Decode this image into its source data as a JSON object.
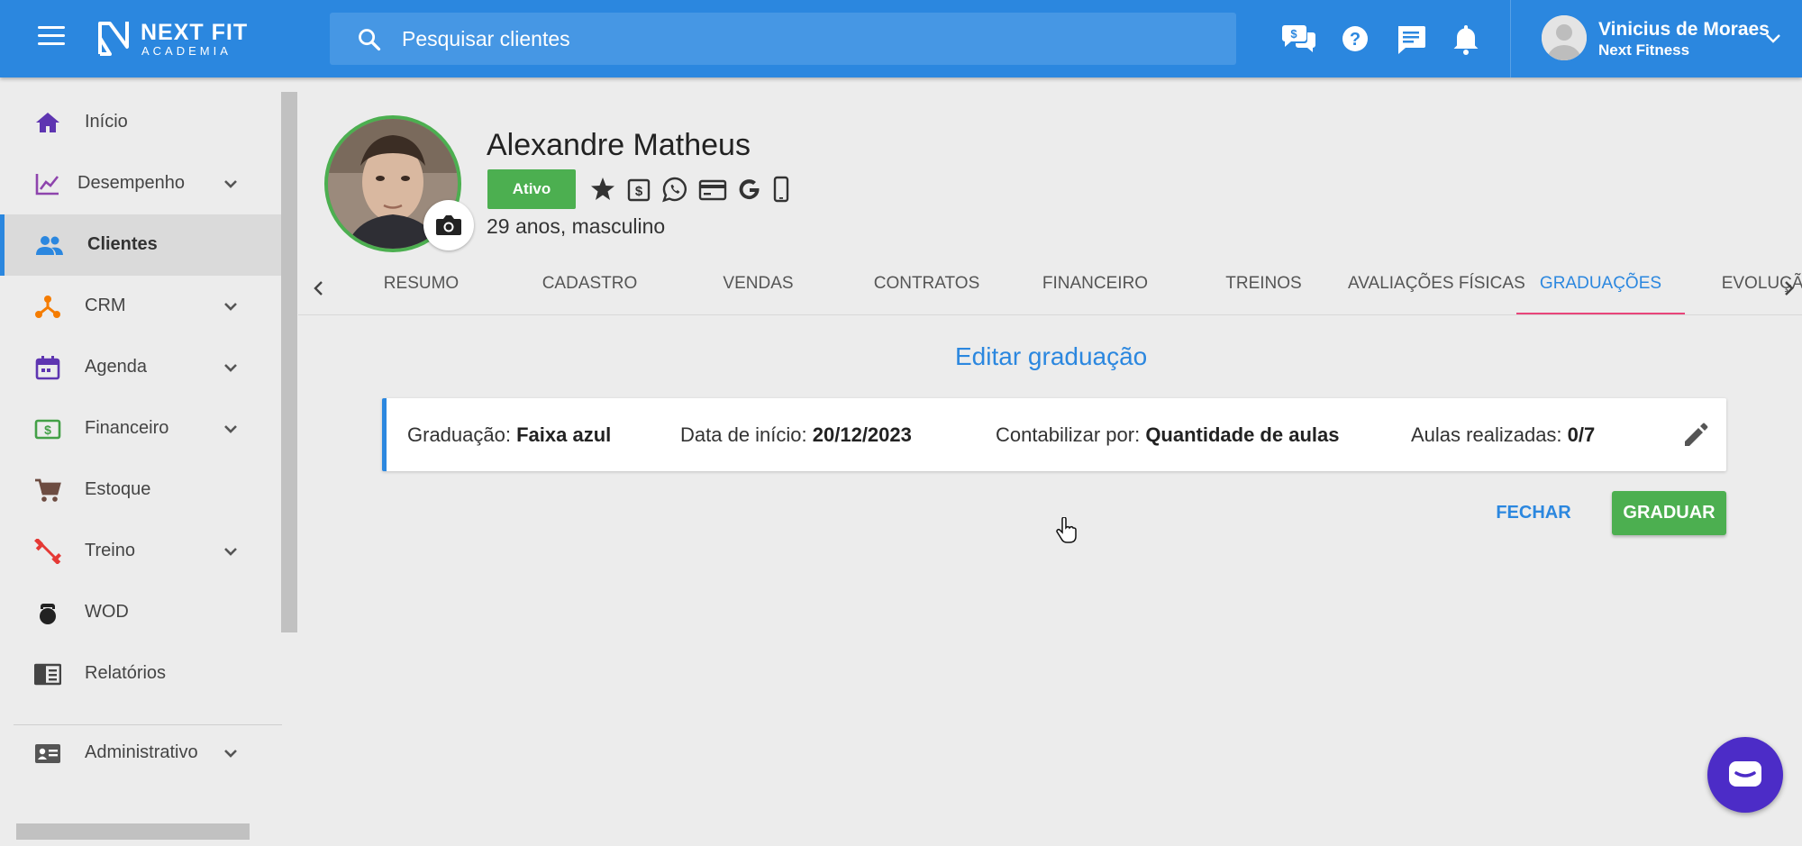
{
  "header": {
    "logo_line1": "NEXT FIT",
    "logo_line2": "ACADEMIA",
    "search": {
      "placeholder": "Pesquisar clientes"
    },
    "icons": [
      "chat-money-icon",
      "help-icon",
      "message-icon",
      "bell-icon"
    ],
    "user": {
      "name": "Vinicius de Moraes",
      "company": "Next Fitness"
    },
    "accent": "#2b87df"
  },
  "sidebar": {
    "items": [
      {
        "label": "Início",
        "icon": "home-icon",
        "color": "#5e35b1",
        "expandable": false,
        "active": false
      },
      {
        "label": "Desempenho",
        "icon": "chart-icon",
        "color": "#8e44ad",
        "expandable": true,
        "active": false
      },
      {
        "label": "Clientes",
        "icon": "people-icon",
        "color": "#2b87df",
        "expandable": false,
        "active": true
      },
      {
        "label": "CRM",
        "icon": "crm-icon",
        "color": "#f57c00",
        "expandable": true,
        "active": false
      },
      {
        "label": "Agenda",
        "icon": "calendar-icon",
        "color": "#5e35b1",
        "expandable": true,
        "active": false
      },
      {
        "label": "Financeiro",
        "icon": "money-icon",
        "color": "#43a047",
        "expandable": true,
        "active": false
      },
      {
        "label": "Estoque",
        "icon": "cart-icon",
        "color": "#6d4c41",
        "expandable": false,
        "active": false
      },
      {
        "label": "Treino",
        "icon": "dumbbell-icon",
        "color": "#e53935",
        "expandable": true,
        "active": false
      },
      {
        "label": "WOD",
        "icon": "kettlebell-icon",
        "color": "#222222",
        "expandable": false,
        "active": false
      },
      {
        "label": "Relatórios",
        "icon": "report-icon",
        "color": "#444444",
        "expandable": false,
        "active": false
      },
      {
        "label": "Administrativo",
        "icon": "id-card-icon",
        "color": "#555555",
        "expandable": true,
        "active": false
      }
    ]
  },
  "client": {
    "name": "Alexandre Matheus",
    "status": "Ativo",
    "status_color": "#4caf50",
    "info": "29 anos, masculino",
    "icons": [
      "star-icon",
      "dollar-icon",
      "whatsapp-icon",
      "credit-card-icon",
      "google-icon",
      "phone-icon"
    ]
  },
  "tabs": [
    {
      "label": "RESUMO",
      "active": false
    },
    {
      "label": "CADASTRO",
      "active": false
    },
    {
      "label": "VENDAS",
      "active": false
    },
    {
      "label": "CONTRATOS",
      "active": false
    },
    {
      "label": "FINANCEIRO",
      "active": false
    },
    {
      "label": "TREINOS",
      "active": false
    },
    {
      "label": "AVALIAÇÕES FÍSICAS",
      "active": false
    },
    {
      "label": "GRADUAÇÕES",
      "active": true
    },
    {
      "label": "EVOLUÇÃO",
      "active": false
    }
  ],
  "main": {
    "title": "Editar graduação",
    "graduation": {
      "graduation_label": "Graduação:",
      "graduation_value": "Faixa azul",
      "start_label": "Data de início:",
      "start_value": "20/12/2023",
      "count_label": "Contabilizar por:",
      "count_value": "Quantidade de aulas",
      "classes_label": "Aulas realizadas:",
      "classes_value": "0/7"
    },
    "close_label": "FECHAR",
    "graduate_label": "GRADUAR"
  }
}
